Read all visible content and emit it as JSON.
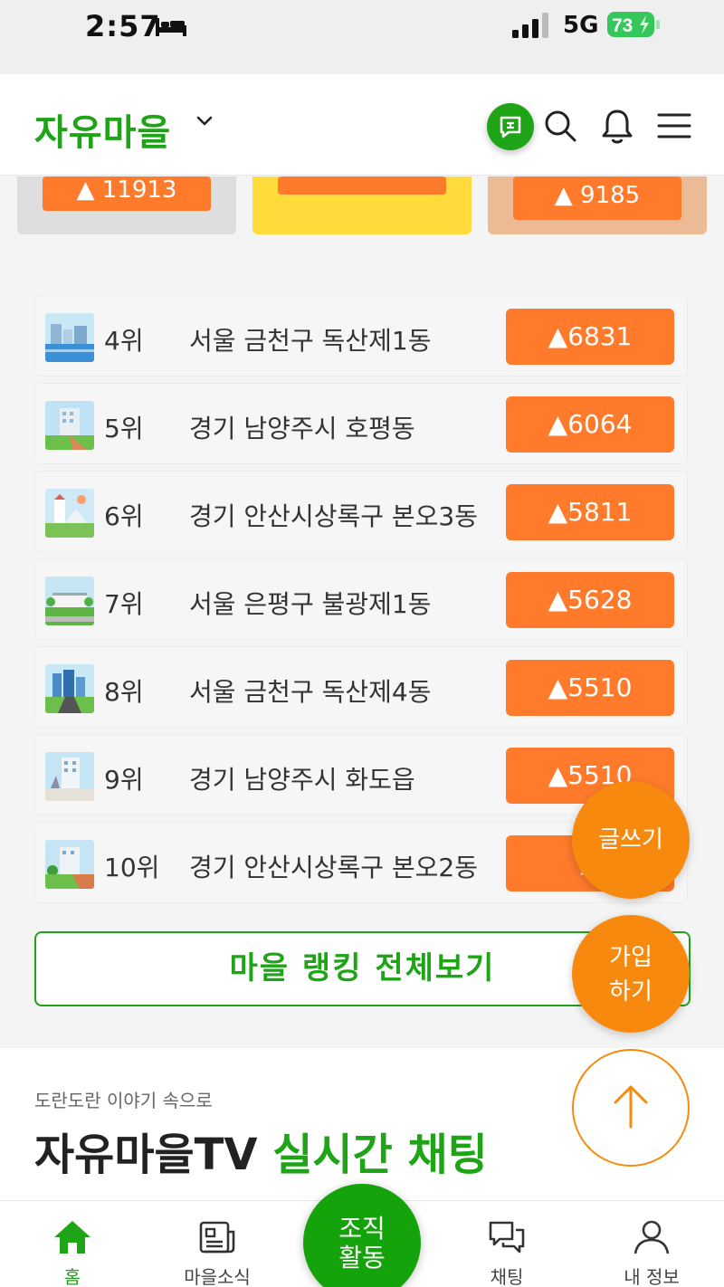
{
  "status_bar": {
    "time": "2:57",
    "network": "5G",
    "battery": "73"
  },
  "header": {
    "title": "자유마을"
  },
  "top_badges": [
    "11913",
    "9185"
  ],
  "ranking": [
    {
      "rank": "4위",
      "name": "서울 금천구 독산제1동",
      "score": "6831"
    },
    {
      "rank": "5위",
      "name": "경기 남양주시 호평동",
      "score": "6064"
    },
    {
      "rank": "6위",
      "name": "경기 안산시상록구 본오3동",
      "score": "5811"
    },
    {
      "rank": "7위",
      "name": "서울 은평구 불광제1동",
      "score": "5628"
    },
    {
      "rank": "8위",
      "name": "서울 금천구 독산제4동",
      "score": "5510"
    },
    {
      "rank": "9위",
      "name": "경기 남양주시 화도읍",
      "score": "5510"
    },
    {
      "rank": "10위",
      "name": "경기 안산시상록구 본오2동",
      "score": ""
    }
  ],
  "all_ranking_button": "마을 랭킹 전체보기",
  "tv_section": {
    "subtitle": "도란도란 이야기 속으로",
    "title_dark": "자유마을TV ",
    "title_green": "실시간 채팅"
  },
  "fabs": {
    "write": "글쓰기",
    "join_line1": "가입",
    "join_line2": "하기"
  },
  "bottom_nav": {
    "home": "홈",
    "news": "마을소식",
    "center_line1": "조직",
    "center_line2": "활동",
    "chat": "채팅",
    "profile": "내 정보"
  },
  "colors": {
    "brand_green": "#1fa317",
    "accent_orange": "#ff7a2b",
    "fab_orange": "#f7890e"
  },
  "icons": [
    "bed-icon",
    "signal-icon",
    "battery-icon",
    "chevron-down-icon",
    "chat-bubble-icon",
    "search-icon",
    "bell-icon",
    "menu-icon",
    "arrow-up-icon",
    "home-icon",
    "news-icon",
    "chat-icon",
    "user-icon"
  ]
}
